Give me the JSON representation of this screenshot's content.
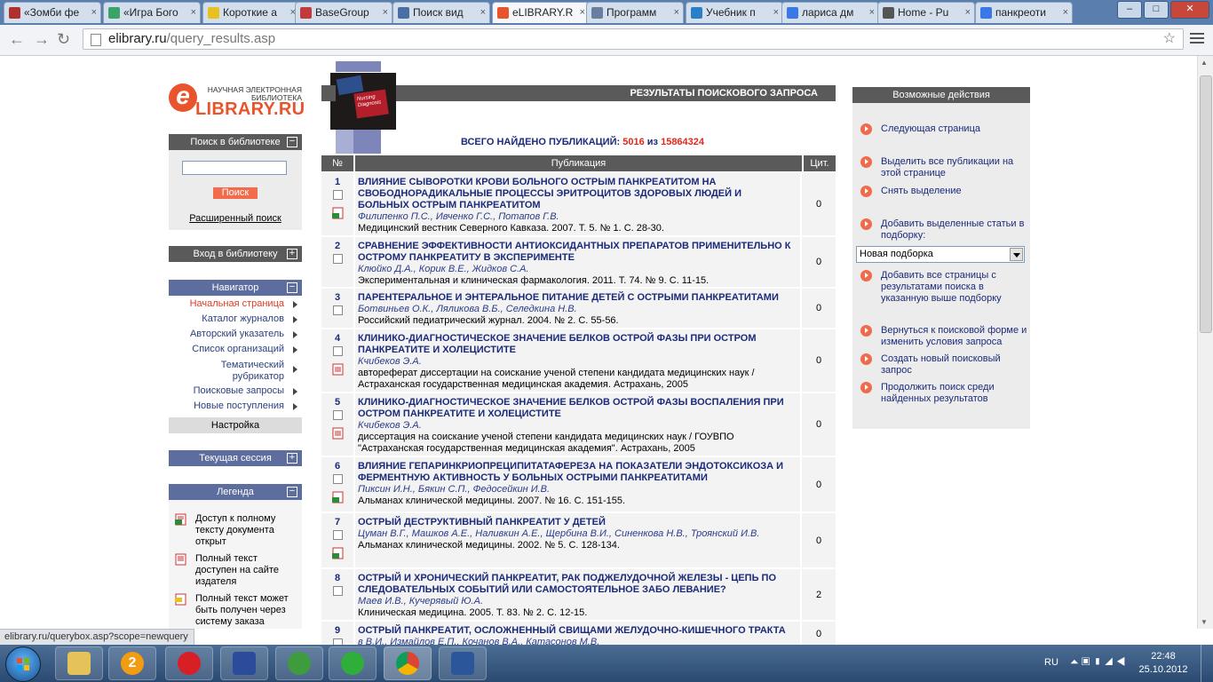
{
  "browser": {
    "tabs": [
      {
        "label": "«Зомби фе",
        "color": "#b03030"
      },
      {
        "label": "«Игра Бого",
        "color": "#3aa36a"
      },
      {
        "label": "Короткие а",
        "color": "#e8c020"
      },
      {
        "label": "BaseGroup",
        "color": "#c23a3a"
      },
      {
        "label": "Поиск вид",
        "color": "#4a6fa5"
      },
      {
        "label": "eLIBRARY.R",
        "color": "#e8552c"
      },
      {
        "label": "Программ",
        "color": "#6a7fa0"
      },
      {
        "label": "Учебник п",
        "color": "#2a80c8"
      },
      {
        "label": "лариса дм",
        "color": "#3b78e7"
      },
      {
        "label": "Home - Pu",
        "color": "#555555"
      },
      {
        "label": "панкреоти",
        "color": "#3b78e7"
      }
    ],
    "url_domain": "elibrary.ru",
    "url_path": "/query_results.asp",
    "status_url": "elibrary.ru/querybox.asp?scope=newquery"
  },
  "logo": {
    "tagline_line1": "НАУЧНАЯ ЭЛЕКТРОННАЯ",
    "tagline_line2": "БИБЛИОТЕКА",
    "letter": "e",
    "name": "LIBRARY.RU"
  },
  "left": {
    "search_title": "Поиск в библиотеке",
    "search_button": "Поиск",
    "advanced_search": "Расширенный поиск",
    "login_title": "Вход в библиотеку",
    "navigator_title": "Навигатор",
    "nav_items": [
      "Начальная страница",
      "Каталог журналов",
      "Авторский указатель",
      "Список организаций",
      "Тематический рубрикатор",
      "Поисковые запросы",
      "Новые поступления"
    ],
    "settings": "Настройка",
    "session_title": "Текущая сессия",
    "legend_title": "Легенда",
    "legend_items": [
      "Доступ к полному тексту документа открыт",
      "Полный текст доступен на сайте издателя",
      "Полный текст может быть получен через систему заказа"
    ],
    "toggle_minus": "−",
    "toggle_plus": "+"
  },
  "book_image_text": "Nursing Diagnosis",
  "center": {
    "header": "РЕЗУЛЬТАТЫ ПОИСКОВОГО ЗАПРОСА",
    "total_label": "ВСЕГО НАЙДЕНО ПУБЛИКАЦИЙ:",
    "total_found": "5016",
    "total_of": "из",
    "total_all": "15864324",
    "col_num": "№",
    "col_pub": "Публикация",
    "col_cit": "Цит.",
    "rows": [
      {
        "num": "1",
        "title": "ВЛИЯНИЕ СЫВОРОТКИ КРОВИ БОЛЬНОГО ОСТРЫМ ПАНКРЕАТИТОМ НА СВОБОДНОРАДИКАЛЬНЫЕ ПРОЦЕССЫ ЭРИТРОЦИТОВ ЗДОРОВЫХ ЛЮДЕЙ И БОЛЬНЫХ ОСТРЫМ ПАНКРЕАТИТОМ",
        "authors": "Филипенко П.С., Ивченко Г.С., Потапов Г.В.",
        "source": "Медицинский вестник Северного Кавказа. 2007. Т. 5. № 1. С. 28-30.",
        "cit": "0"
      },
      {
        "num": "2",
        "title": "СРАВНЕНИЕ ЭФФЕКТИВНОСТИ АНТИОКСИДАНТНЫХ ПРЕПАРАТОВ ПРИМЕНИТЕЛЬНО К ОСТРОМУ ПАНКРЕАТИТУ В ЭКСПЕРИМЕНТЕ",
        "authors": "Клюйко Д.А., Корик В.Е., Жидков С.А.",
        "source": "Экспериментальная и клиническая фармакология. 2011. Т. 74. № 9. С. 11-15.",
        "cit": "0"
      },
      {
        "num": "3",
        "title": "ПАРЕНТЕРАЛЬНОЕ И ЭНТЕРАЛЬНОЕ ПИТАНИЕ ДЕТЕЙ С ОСТРЫМИ ПАНКРЕАТИТАМИ",
        "authors": "Ботвиньев О.К., Ляликова В.Б., Селедкина Н.В.",
        "source": "Российский педиатрический журнал. 2004. № 2. С. 55-56.",
        "cit": "0"
      },
      {
        "num": "4",
        "title": "КЛИНИКО-ДИАГНОСТИЧЕСКОЕ ЗНАЧЕНИЕ БЕЛКОВ ОСТРОЙ ФАЗЫ ПРИ ОСТРОМ ПАНКРЕАТИТЕ И ХОЛЕЦИСТИТЕ",
        "authors": "Кчибеков Э.А.",
        "source": "автореферат диссертации на соискание ученой степени кандидата медицинских наук / Астраханская государственная медицинская академия. Астрахань, 2005",
        "cit": "0"
      },
      {
        "num": "5",
        "title": "КЛИНИКО-ДИАГНОСТИЧЕСКОЕ ЗНАЧЕНИЕ БЕЛКОВ ОСТРОЙ ФАЗЫ ВОСПАЛЕНИЯ ПРИ ОСТРОМ ПАНКРЕАТИТЕ И ХОЛЕЦИСТИТЕ",
        "authors": "Кчибеков Э.А.",
        "source": "диссертация на соискание ученой степени кандидата медицинских наук / ГОУВПО \"Астраханская государственная медицинская академия\". Астрахань, 2005",
        "cit": "0"
      },
      {
        "num": "6",
        "title": "ВЛИЯНИЕ ГЕПАРИНКРИОПРЕЦИПИТАТАФЕРЕЗА НА ПОКАЗАТЕЛИ ЭНДОТОКСИКОЗА И ФЕРМЕНТНУЮ АКТИВНОСТЬ У БОЛЬНЫХ ОСТРЫМИ ПАНКРЕАТИТАМИ",
        "authors": "Пиксин И.Н., Бякин С.П., Федосейкин И.В.",
        "source": "Альманах клинической медицины. 2007. № 16. С. 151-155.",
        "cit": "0"
      },
      {
        "num": "7",
        "title": "ОСТРЫЙ ДЕСТРУКТИВНЫЙ ПАНКРЕАТИТ У ДЕТЕЙ",
        "authors": "Цуман В.Г., Машков А.Е., Наливкин А.Е., Щербина В.И., Синенкова Н.В., Троянский И.В.",
        "source": "Альманах клинической медицины. 2002. № 5. С. 128-134.",
        "cit": "0"
      },
      {
        "num": "8",
        "title": "ОСТРЫЙ И ХРОНИЧЕСКИЙ ПАНКРЕАТИТ, РАК ПОДЖЕЛУДОЧНОЙ ЖЕЛЕЗЫ - ЦЕПЬ ПО СЛЕДОВАТЕЛЬНЫХ СОБЫТИЙ ИЛИ САМОСТОЯТЕЛЬНОЕ ЗАБО ЛЕВАНИЕ?",
        "authors": "Маев И.В., Кучерявый Ю.А.",
        "source": "Клиническая медицина. 2005. Т. 83. № 2. С. 12-15.",
        "cit": "2"
      },
      {
        "num": "9",
        "title": "ОСТРЫЙ ПАНКРЕАТИТ, ОСЛОЖНЕННЫЙ СВИЩАМИ ЖЕЛУДОЧНО-КИШЕЧНОГО ТРАКТА",
        "authors": "в В.И., Измайлов Е.П., Кочанов В.А., Катасонов М.В.",
        "source": "",
        "cit": "0"
      }
    ]
  },
  "right": {
    "title": "Возможные действия",
    "actions": [
      "Следующая страница",
      "Выделить все публикации на этой странице",
      "Снять выделение",
      "Добавить выделенные статьи в подборку:",
      "Добавить все страницы с результатами поиска в указанную выше подборку",
      "Вернуться к поисковой форме и изменить условия запроса",
      "Создать новый поисковый запрос",
      "Продолжить поиск среди найденных результатов"
    ],
    "select_value": "Новая подборка"
  },
  "taskbar": {
    "lang": "RU",
    "time": "22:48",
    "date": "25.10.2012",
    "badge": "2"
  },
  "colors": {
    "accent": "#e8552c",
    "title_blue": "#1b2a7a",
    "header_gray": "#5a5a5a",
    "nav_blue": "#5d6e9e"
  }
}
